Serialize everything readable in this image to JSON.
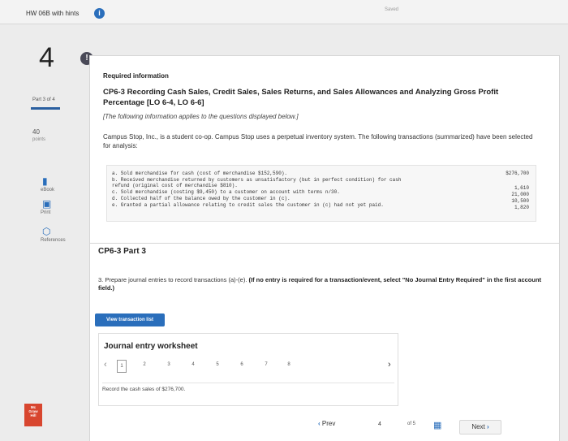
{
  "header": {
    "assignment_title": "HW 06B with hints",
    "saved_label": "Saved"
  },
  "question": {
    "number": "4"
  },
  "sidebar": {
    "part_of": "Part 3 of 4",
    "points_value": "40",
    "points_label": "points",
    "tools": [
      {
        "label": "eBook"
      },
      {
        "label": "Print"
      },
      {
        "label": "References"
      }
    ]
  },
  "required_info": {
    "title": "Required information",
    "heading": "CP6-3 Recording Cash Sales, Credit Sales, Sales Returns, and Sales Allowances and Analyzing Gross Profit Percentage [LO 6-4, LO 6-6]",
    "note": "[The following information applies to the questions displayed below.]",
    "description": "Campus Stop, Inc., is a student co-op. Campus Stop uses a perpetual inventory system. The following transactions (summarized) have been selected for analysis:"
  },
  "transactions": [
    {
      "text": "a. Sold merchandise for cash (cost of merchandise $152,590).",
      "amount": "$276,700"
    },
    {
      "text": "b. Received merchandise returned by customers as unsatisfactory (but in perfect condition) for cash",
      "amount": ""
    },
    {
      "text": "   refund (original cost of merchandise $810).",
      "amount": "1,610"
    },
    {
      "text": "c. Sold merchandise (costing $9,450) to a customer on account with terms n/30.",
      "amount": "21,000"
    },
    {
      "text": "d. Collected half of the balance owed by the customer in (c).",
      "amount": "10,500"
    },
    {
      "text": "e. Granted a partial allowance relating to credit sales the customer in (c) had not yet paid.",
      "amount": "1,820"
    }
  ],
  "part": {
    "title": "CP6-3 Part 3",
    "instruction_text": "3. Prepare journal entries to record transactions (a)-(e).",
    "instruction_bold": " (If no entry is required for a transaction/event, select \"No Journal Entry Required\" in the first account field.)",
    "view_button": "View transaction list"
  },
  "worksheet": {
    "title": "Journal entry worksheet",
    "steps": [
      "1",
      "2",
      "3",
      "4",
      "5",
      "6",
      "7",
      "8"
    ],
    "record_text": "Record the cash sales of $276,700."
  },
  "footer": {
    "prev_label": "Prev",
    "current_page": "4",
    "of_label": "of 5",
    "next_label": "Next"
  },
  "logo": {
    "lines": [
      "Mc",
      "Graw",
      "Hill"
    ]
  },
  "colors": {
    "accent": "#2a6ebb",
    "logo_red": "#d8462f"
  },
  "icons": {
    "info": "info-icon",
    "alert": "alert-icon",
    "ebook": "book-icon",
    "print": "printer-icon",
    "references": "reference-icon",
    "grid": "grid-icon"
  }
}
